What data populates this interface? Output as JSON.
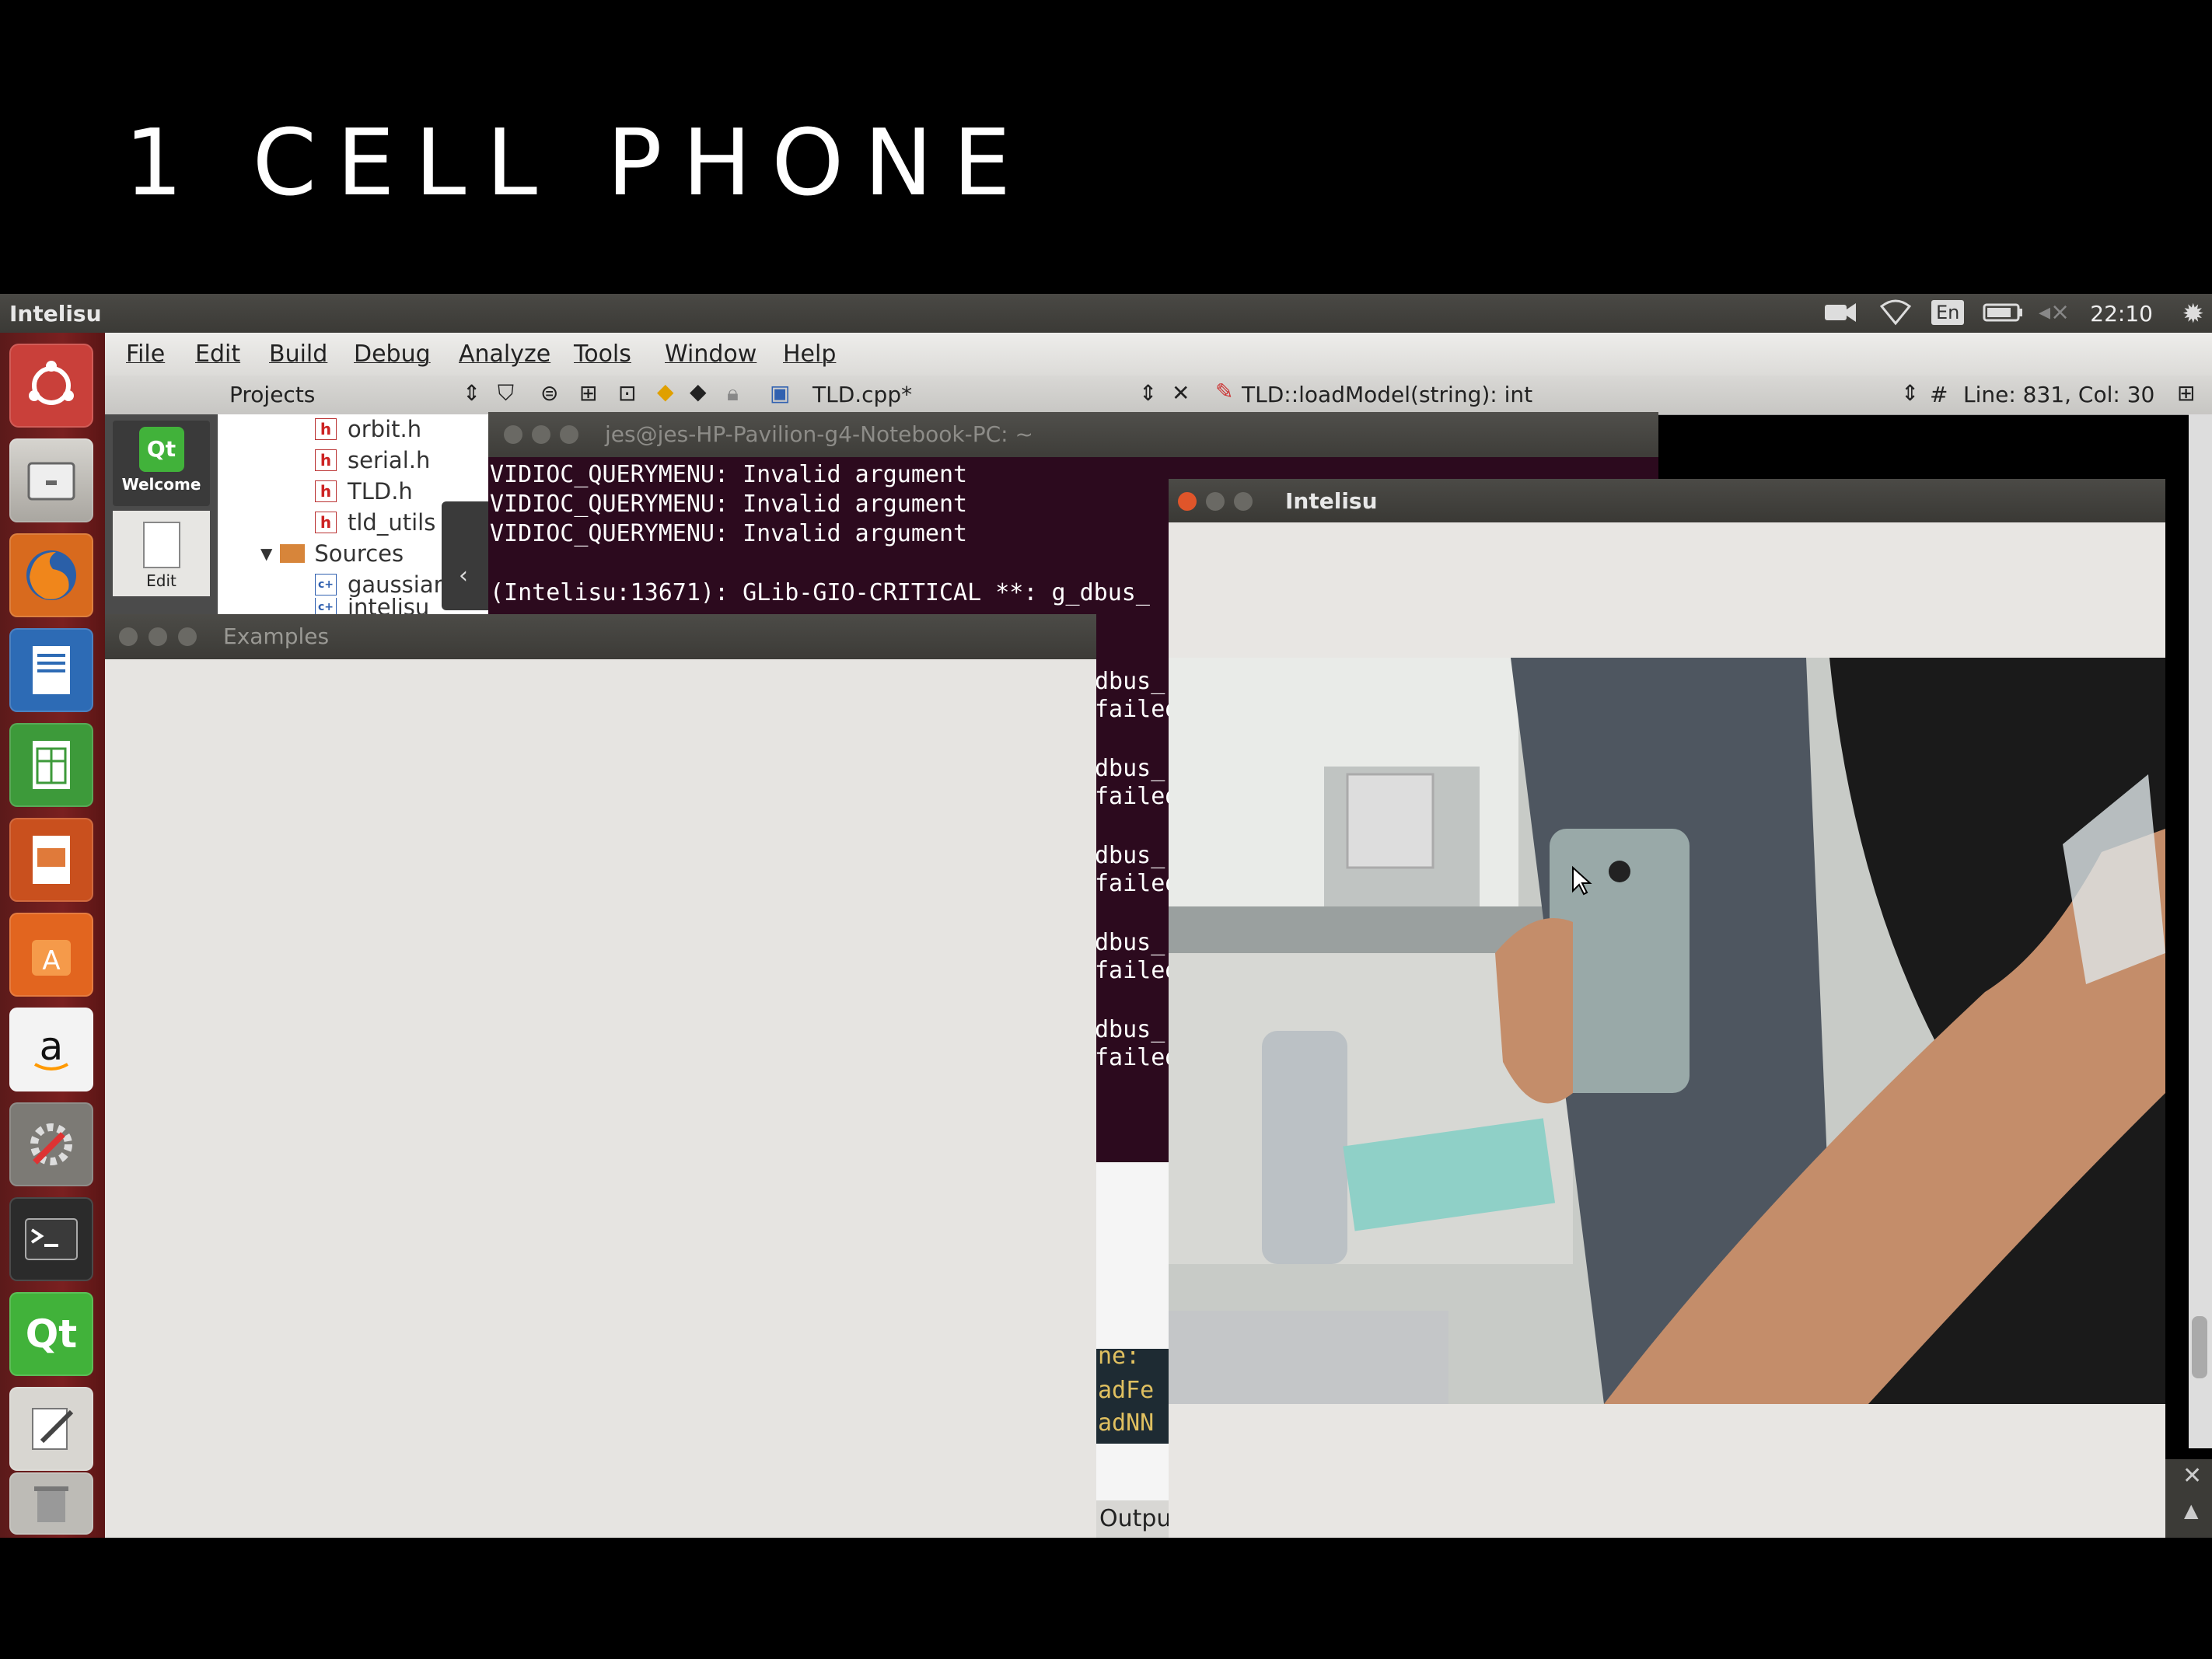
{
  "slide": {
    "title": "1 CELL PHONE"
  },
  "top_panel": {
    "app_title": "Intelisu",
    "keyboard_layout": "En",
    "clock": "22:10"
  },
  "menu": {
    "items": [
      "File",
      "Edit",
      "Build",
      "Debug",
      "Analyze",
      "Tools",
      "Window",
      "Help"
    ]
  },
  "toolbar": {
    "projects_label": "Projects",
    "file_tab": "TLD.cpp*",
    "function_selector": "TLD::loadModel(string): int",
    "cursor_position": "Line: 831, Col: 30",
    "hash": "#"
  },
  "modes": {
    "welcome": "Welcome",
    "edit": "Edit",
    "qt_logo": "Qt"
  },
  "project_tree": {
    "files": [
      "orbit.h",
      "serial.h",
      "TLD.h",
      "tld_utils"
    ],
    "folder": "Sources",
    "sources": [
      "gaussiar",
      "intelisu"
    ],
    "badge_h": "h",
    "badge_cpp": "c+"
  },
  "terminal": {
    "title": "jes@jes-HP-Pavilion-g4-Notebook-PC: ~",
    "lines": [
      "VIDIOC_QUERYMENU: Invalid argument",
      "VIDIOC_QUERYMENU: Invalid argument",
      "VIDIOC_QUERYMENU: Invalid argument",
      "",
      "(Intelisu:13671): GLib-GIO-CRITICAL **: g_dbus_",
      "",
      "dbus_",
      "failed",
      "",
      "dbus_",
      "failed",
      "",
      "dbus_",
      "failed",
      "",
      "dbus_",
      "failed",
      "",
      "dbus_",
      "failed"
    ],
    "code_fragments": [
      "ne:",
      "adFe",
      "adNN"
    ]
  },
  "examples_window": {
    "title": "Examples"
  },
  "camera_window": {
    "title": "Intelisu"
  },
  "output_tab": "Outpu",
  "colors": {
    "launcher": "#7a2020",
    "terminal_bg": "#2c0a1e",
    "panel": "#3c3b37"
  },
  "launcher_icons": [
    "dash-icon",
    "files-icon",
    "firefox-icon",
    "writer-icon",
    "calc-icon",
    "impress-icon",
    "software-center-icon",
    "amazon-icon",
    "settings-icon",
    "terminal-icon",
    "qt-creator-icon",
    "text-editor-icon",
    "trash-icon"
  ]
}
